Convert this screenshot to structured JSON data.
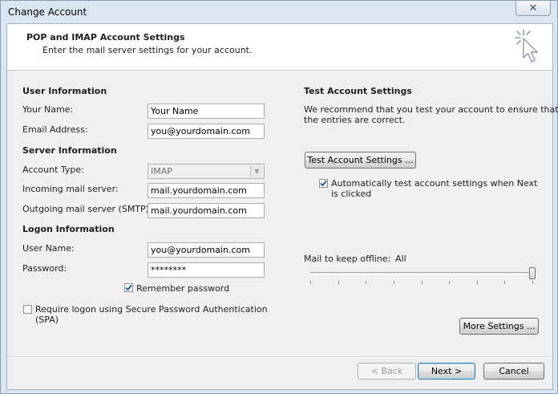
{
  "window": {
    "title": "Change Account",
    "close_glyph": "✕"
  },
  "header": {
    "title": "POP and IMAP Account Settings",
    "subtitle": "Enter the mail server settings for your account."
  },
  "user_info": {
    "heading": "User Information",
    "name_label": "Your Name:",
    "name_value": "Your Name",
    "email_label": "Email Address:",
    "email_value": "you@yourdomain.com"
  },
  "server_info": {
    "heading": "Server Information",
    "account_type_label": "Account Type:",
    "account_type_value": "IMAP",
    "incoming_label": "Incoming mail server:",
    "incoming_value": "mail.yourdomain.com",
    "outgoing_label": "Outgoing mail server (SMTP):",
    "outgoing_value": "mail.yourdomain.com"
  },
  "logon_info": {
    "heading": "Logon Information",
    "username_label": "User Name:",
    "username_value": "you@yourdomain.com",
    "password_label": "Password:",
    "password_value": "********",
    "remember_label": "Remember password",
    "remember_checked": true,
    "spa_label_line1": "Require logon using Secure Password Authentication",
    "spa_label_line2": "(SPA)",
    "spa_checked": false
  },
  "test_settings": {
    "heading": "Test Account Settings",
    "desc_line1": "We recommend that you test your account to ensure that",
    "desc_line2": "the entries are correct.",
    "test_button": "Test Account Settings ...",
    "auto_label_line1": "Automatically test account settings when Next",
    "auto_label_line2": "is clicked",
    "auto_checked": true
  },
  "offline": {
    "label": "Mail to keep offline:",
    "value": "All",
    "level_fraction": 1.0,
    "tick_count": 9
  },
  "buttons": {
    "more_settings": "More Settings ...",
    "back": "< Back",
    "next": "Next >",
    "cancel": "Cancel"
  },
  "colors": {
    "check_mark": "#2a4f85",
    "dialog_bg": "#f0f0f0"
  }
}
